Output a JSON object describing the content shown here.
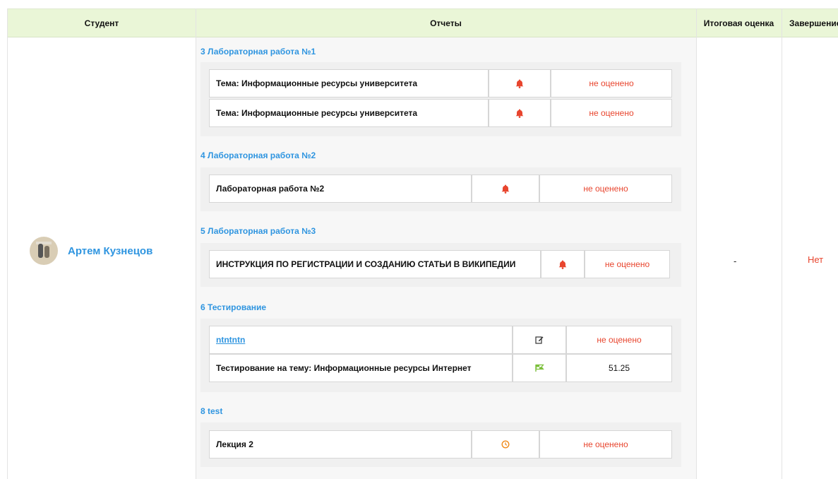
{
  "header": {
    "student": "Студент",
    "reports": "Отчеты",
    "final_grade": "Итоговая оценка",
    "completion": "Завершение"
  },
  "student": {
    "name": "Артем Кузнецов"
  },
  "final_grade": "-",
  "completion": "Нет",
  "sections": [
    {
      "title": "3 Лабораторная работа №1",
      "items": [
        {
          "name": "Тема: Информационные ресурсы университета",
          "icon": "bell-icon",
          "status": "не оценено"
        },
        {
          "name": "Тема: Информационные ресурсы университета",
          "icon": "bell-icon",
          "status": "не оценено"
        }
      ]
    },
    {
      "title": "4 Лабораторная работа №2",
      "items": [
        {
          "name": "Лабораторная работа №2",
          "icon": "bell-icon",
          "status": "не оценено"
        }
      ]
    },
    {
      "title": "5 Лабораторная работа №3",
      "items": [
        {
          "name": "ИНСТРУКЦИЯ ПО РЕГИСТРАЦИИ И СОЗДАНИЮ СТАТЬИ В ВИКИПЕДИИ",
          "icon": "bell-icon",
          "status": "не оценено"
        }
      ]
    },
    {
      "title": "6 Тестирование",
      "items": [
        {
          "name": "ntntntn",
          "icon": "edit-icon",
          "status": "не оценено"
        },
        {
          "name": "Тестирование на тему: Информационные ресурсы Интернет",
          "icon": "flag-icon",
          "status": "51.25"
        }
      ]
    },
    {
      "title": "8 test",
      "items": [
        {
          "name": "Лекция 2",
          "icon": "clock-icon",
          "status": "не оценено"
        }
      ]
    }
  ],
  "colors": {
    "header_bg": "#eaf6d7",
    "link": "#2f95e0",
    "alert": "#e8452e",
    "flag": "#7bbf3a",
    "clock": "#f08a1a"
  }
}
